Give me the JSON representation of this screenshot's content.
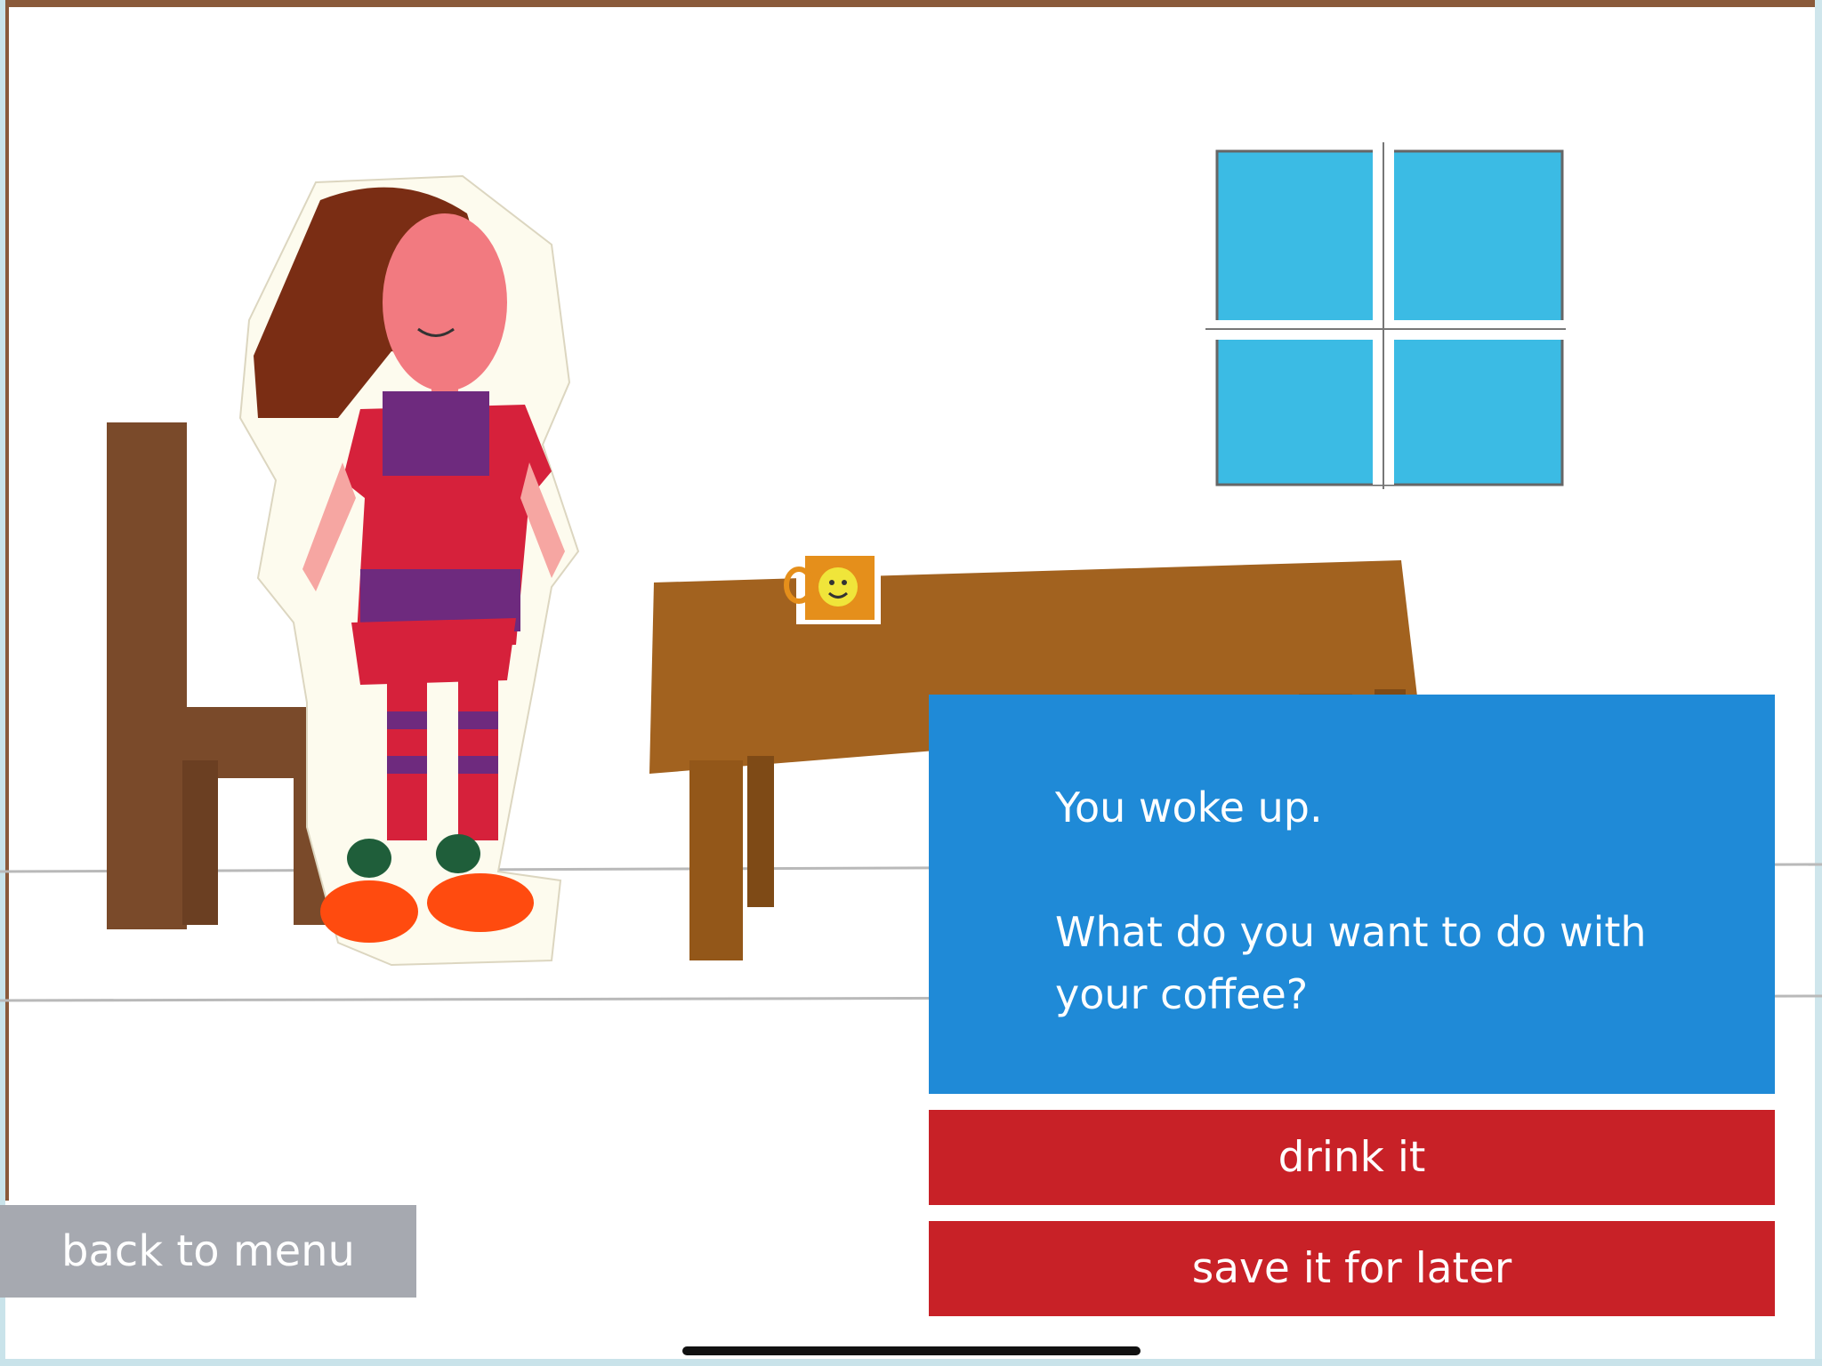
{
  "game": {
    "story": {
      "line1": "You woke up.",
      "line2": "What do you want to do with your coffee?"
    },
    "choices": [
      {
        "label": "drink it"
      },
      {
        "label": "save it for later"
      }
    ],
    "back_label": "back to menu"
  },
  "colors": {
    "dialog_blue": "#1f8ad7",
    "choice_red": "#c82127",
    "back_gray": "#a6a9b0"
  },
  "icons": [
    "chair",
    "girl-character",
    "table",
    "coffee-mug",
    "window"
  ]
}
